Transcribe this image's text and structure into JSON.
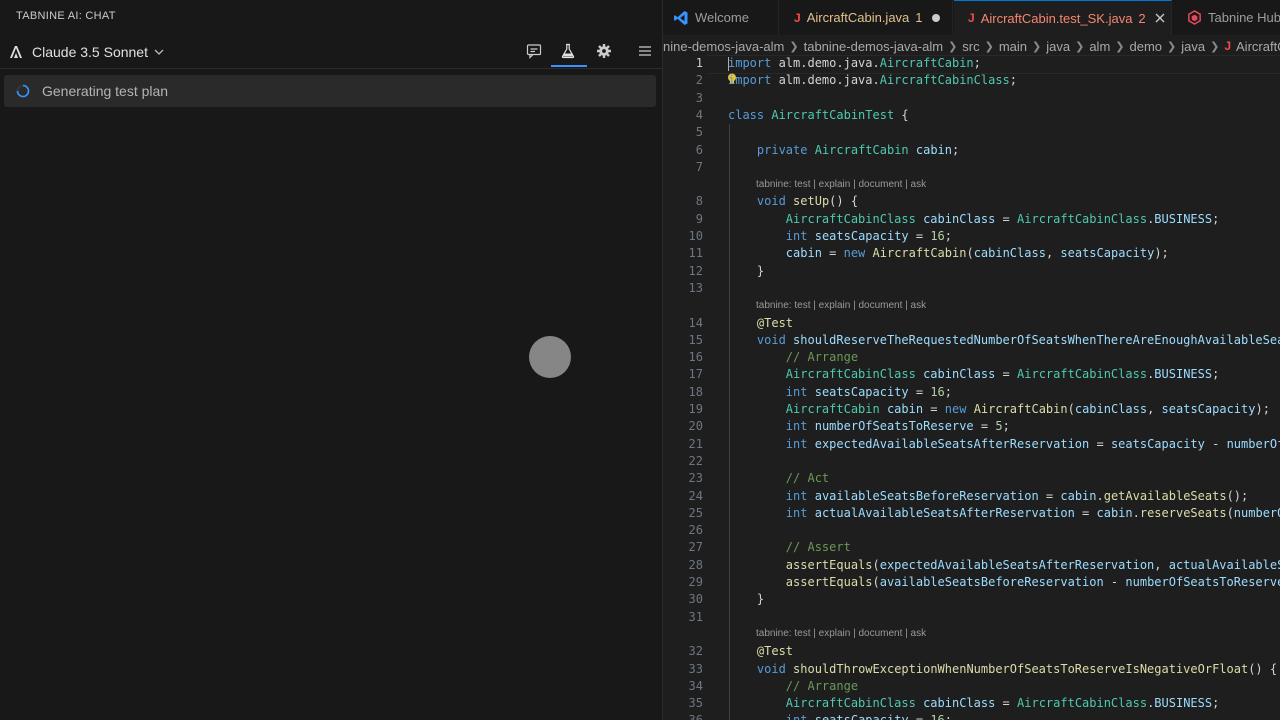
{
  "chat": {
    "title": "TABNINE AI: CHAT",
    "model": "Claude 3.5 Sonnet",
    "status": "Generating test plan",
    "icons": [
      "tabnine-logo-icon",
      "chevron-down-icon",
      "chat-history-icon",
      "test-flask-icon",
      "gear-icon",
      "menu-icon",
      "spinner-icon"
    ]
  },
  "editor": {
    "tabs": [
      {
        "label": "Welcome",
        "icon": "vscode-icon"
      },
      {
        "label": "AircraftCabin.java",
        "badge": "1",
        "modified": true,
        "icon": "java-icon"
      },
      {
        "label": "AircraftCabin.test_SK.java",
        "badge": "2",
        "active": true,
        "icon": "java-icon"
      },
      {
        "label": "Tabnine Hub",
        "icon": "tabnine-hub-icon"
      }
    ],
    "breadcrumb": [
      "nine-demos-java-alm",
      "tabnine-demos-java-alm",
      "src",
      "main",
      "java",
      "alm",
      "demo",
      "java",
      "AircraftCab"
    ],
    "codelens": "tabnine: test | explain | document | ask",
    "lines": [
      {
        "n": "1",
        "text": "import alm.demo.java.AircraftCabin;"
      },
      {
        "n": "2",
        "text": "import alm.demo.java.AircraftCabinClass;"
      },
      {
        "n": "3",
        "text": ""
      },
      {
        "n": "4",
        "text": "class AircraftCabinTest {"
      },
      {
        "n": "5",
        "text": ""
      },
      {
        "n": "6",
        "text": "    private AircraftCabin cabin;"
      },
      {
        "n": "7",
        "text": ""
      },
      {
        "n": "8",
        "text": "    void setUp() {"
      },
      {
        "n": "9",
        "text": "        AircraftCabinClass cabinClass = AircraftCabinClass.BUSINESS;"
      },
      {
        "n": "10",
        "text": "        int seatsCapacity = 16;"
      },
      {
        "n": "11",
        "text": "        cabin = new AircraftCabin(cabinClass, seatsCapacity);"
      },
      {
        "n": "12",
        "text": "    }"
      },
      {
        "n": "13",
        "text": ""
      },
      {
        "n": "14",
        "text": "    @Test"
      },
      {
        "n": "15",
        "text": "    void shouldReserveTheRequestedNumberOfSeatsWhenThereAreEnoughAvailableSeats"
      },
      {
        "n": "16",
        "text": "        // Arrange"
      },
      {
        "n": "17",
        "text": "        AircraftCabinClass cabinClass = AircraftCabinClass.BUSINESS;"
      },
      {
        "n": "18",
        "text": "        int seatsCapacity = 16;"
      },
      {
        "n": "19",
        "text": "        AircraftCabin cabin = new AircraftCabin(cabinClass, seatsCapacity);"
      },
      {
        "n": "20",
        "text": "        int numberOfSeatsToReserve = 5;"
      },
      {
        "n": "21",
        "text": "        int expectedAvailableSeatsAfterReservation = seatsCapacity - numberOfSea"
      },
      {
        "n": "22",
        "text": ""
      },
      {
        "n": "23",
        "text": "        // Act"
      },
      {
        "n": "24",
        "text": "        int availableSeatsBeforeReservation = cabin.getAvailableSeats();"
      },
      {
        "n": "25",
        "text": "        int actualAvailableSeatsAfterReservation = cabin.reserveSeats(numberOfSe"
      },
      {
        "n": "26",
        "text": ""
      },
      {
        "n": "27",
        "text": "        // Assert"
      },
      {
        "n": "28",
        "text": "        assertEquals(expectedAvailableSeatsAfterReservation, actualAvailableSeat"
      },
      {
        "n": "29",
        "text": "        assertEquals(availableSeatsBeforeReservation - numberOfSeatsToReserve, a"
      },
      {
        "n": "30",
        "text": "    }"
      },
      {
        "n": "31",
        "text": ""
      },
      {
        "n": "32",
        "text": "    @Test"
      },
      {
        "n": "33",
        "text": "    void shouldThrowExceptionWhenNumberOfSeatsToReserveIsNegativeOrFloat() {"
      },
      {
        "n": "34",
        "text": "        // Arrange"
      },
      {
        "n": "35",
        "text": "        AircraftCabinClass cabinClass = AircraftCabinClass.BUSINESS;"
      },
      {
        "n": "36",
        "text": "        int seatsCapacity = 16;"
      }
    ]
  }
}
